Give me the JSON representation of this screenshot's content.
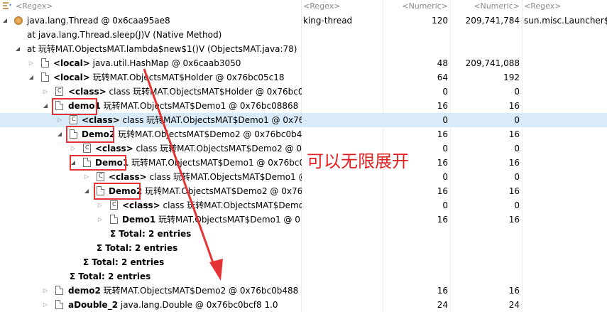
{
  "header": {
    "col0": "<Regex>",
    "col1": "<Regex>",
    "col2": "<Numeric>",
    "col3": "<Numeric>",
    "col4": "<Regex>"
  },
  "rows": [
    {
      "name": "java.lang.Thread @ 0x6caa95ae8",
      "c1": "king-thread",
      "c2": "120",
      "c3": "209,741,784",
      "c4": "sun.misc.Launcher$A"
    },
    {
      "name": "at java.lang.Thread.sleep(J)V (Native Method)",
      "c1": "",
      "c2": "",
      "c3": "",
      "c4": ""
    },
    {
      "name": "at 玩转MAT.ObjectsMAT.lambda$new$1()V (ObjectsMAT.java:78)",
      "c1": "",
      "c2": "",
      "c3": "",
      "c4": ""
    },
    {
      "prefix": "<local>",
      "name": " java.util.HashMap @ 0x6caab3050",
      "c1": "",
      "c2": "48",
      "c3": "209,741,088",
      "c4": ""
    },
    {
      "prefix": "<local>",
      "name": " 玩转MAT.ObjectsMAT$Holder @ 0x76bc05c18",
      "c1": "",
      "c2": "64",
      "c3": "192",
      "c4": ""
    },
    {
      "prefix": "<class>",
      "name": " class 玩转MAT.ObjectsMAT$Holder @ 0x76bc05",
      "c1": "",
      "c2": "0",
      "c3": "0",
      "c4": ""
    },
    {
      "prefix": "demo1",
      "name": " 玩转MAT.ObjectsMAT$Demo1 @ 0x76bc08868",
      "c1": "",
      "c2": "16",
      "c3": "16",
      "c4": ""
    },
    {
      "prefix": "<class>",
      "name": " class 玩转MAT.ObjectsMAT$Demo1 @ 0x768",
      "c1": "",
      "c2": "0",
      "c3": "0",
      "c4": ""
    },
    {
      "prefix": "Demo2",
      "name": " 玩转MAT.ObjectsMAT$Demo2 @ 0x76bc0b4",
      "c1": "",
      "c2": "16",
      "c3": "16",
      "c4": ""
    },
    {
      "prefix": "<class>",
      "name": " class 玩转MAT.ObjectsMAT$Demo2 @ 0x",
      "c1": "",
      "c2": "0",
      "c3": "0",
      "c4": ""
    },
    {
      "prefix": "Demo1",
      "name": " 玩转MAT.ObjectsMAT$Demo1 @ 0x76bc0",
      "c1": "",
      "c2": "16",
      "c3": "16",
      "c4": ""
    },
    {
      "prefix": "<class>",
      "name": " class 玩转MAT.ObjectsMAT$Demo1 @",
      "c1": "",
      "c2": "0",
      "c3": "0",
      "c4": ""
    },
    {
      "prefix": "Demo2",
      "name": " 玩转MAT.ObjectsMAT$Demo2 @ 0x76",
      "c1": "",
      "c2": "16",
      "c3": "16",
      "c4": ""
    },
    {
      "prefix": "<class>",
      "name": " class 玩转MAT.ObjectsMAT$Demo",
      "c1": "",
      "c2": "0",
      "c3": "0",
      "c4": ""
    },
    {
      "prefix": "Demo1",
      "name": " 玩转MAT.ObjectsMAT$Demo1 @ 0",
      "c1": "",
      "c2": "16",
      "c3": "16",
      "c4": ""
    },
    {
      "name": "Total: 2 entries",
      "c1": "",
      "c2": "",
      "c3": "",
      "c4": ""
    },
    {
      "name": "Total: 2 entries",
      "c1": "",
      "c2": "",
      "c3": "",
      "c4": ""
    },
    {
      "name": "Total: 2 entries",
      "c1": "",
      "c2": "",
      "c3": "",
      "c4": ""
    },
    {
      "name": "Total: 2 entries",
      "c1": "",
      "c2": "",
      "c3": "",
      "c4": ""
    },
    {
      "prefix": "demo2",
      "name": " 玩转MAT.ObjectsMAT$Demo2 @ 0x76bc0b488",
      "c1": "",
      "c2": "16",
      "c3": "16",
      "c4": ""
    },
    {
      "prefix": "aDouble_2",
      "name": " java.lang.Double @ 0x76bc0bcf8  1.0",
      "c1": "",
      "c2": "24",
      "c3": "24",
      "c4": ""
    }
  ],
  "annotation": "可以无限展开",
  "colors": {
    "highlight_box": "#e53333",
    "annotation_text": "#e02020",
    "selected_row": "#d9ebf9"
  }
}
